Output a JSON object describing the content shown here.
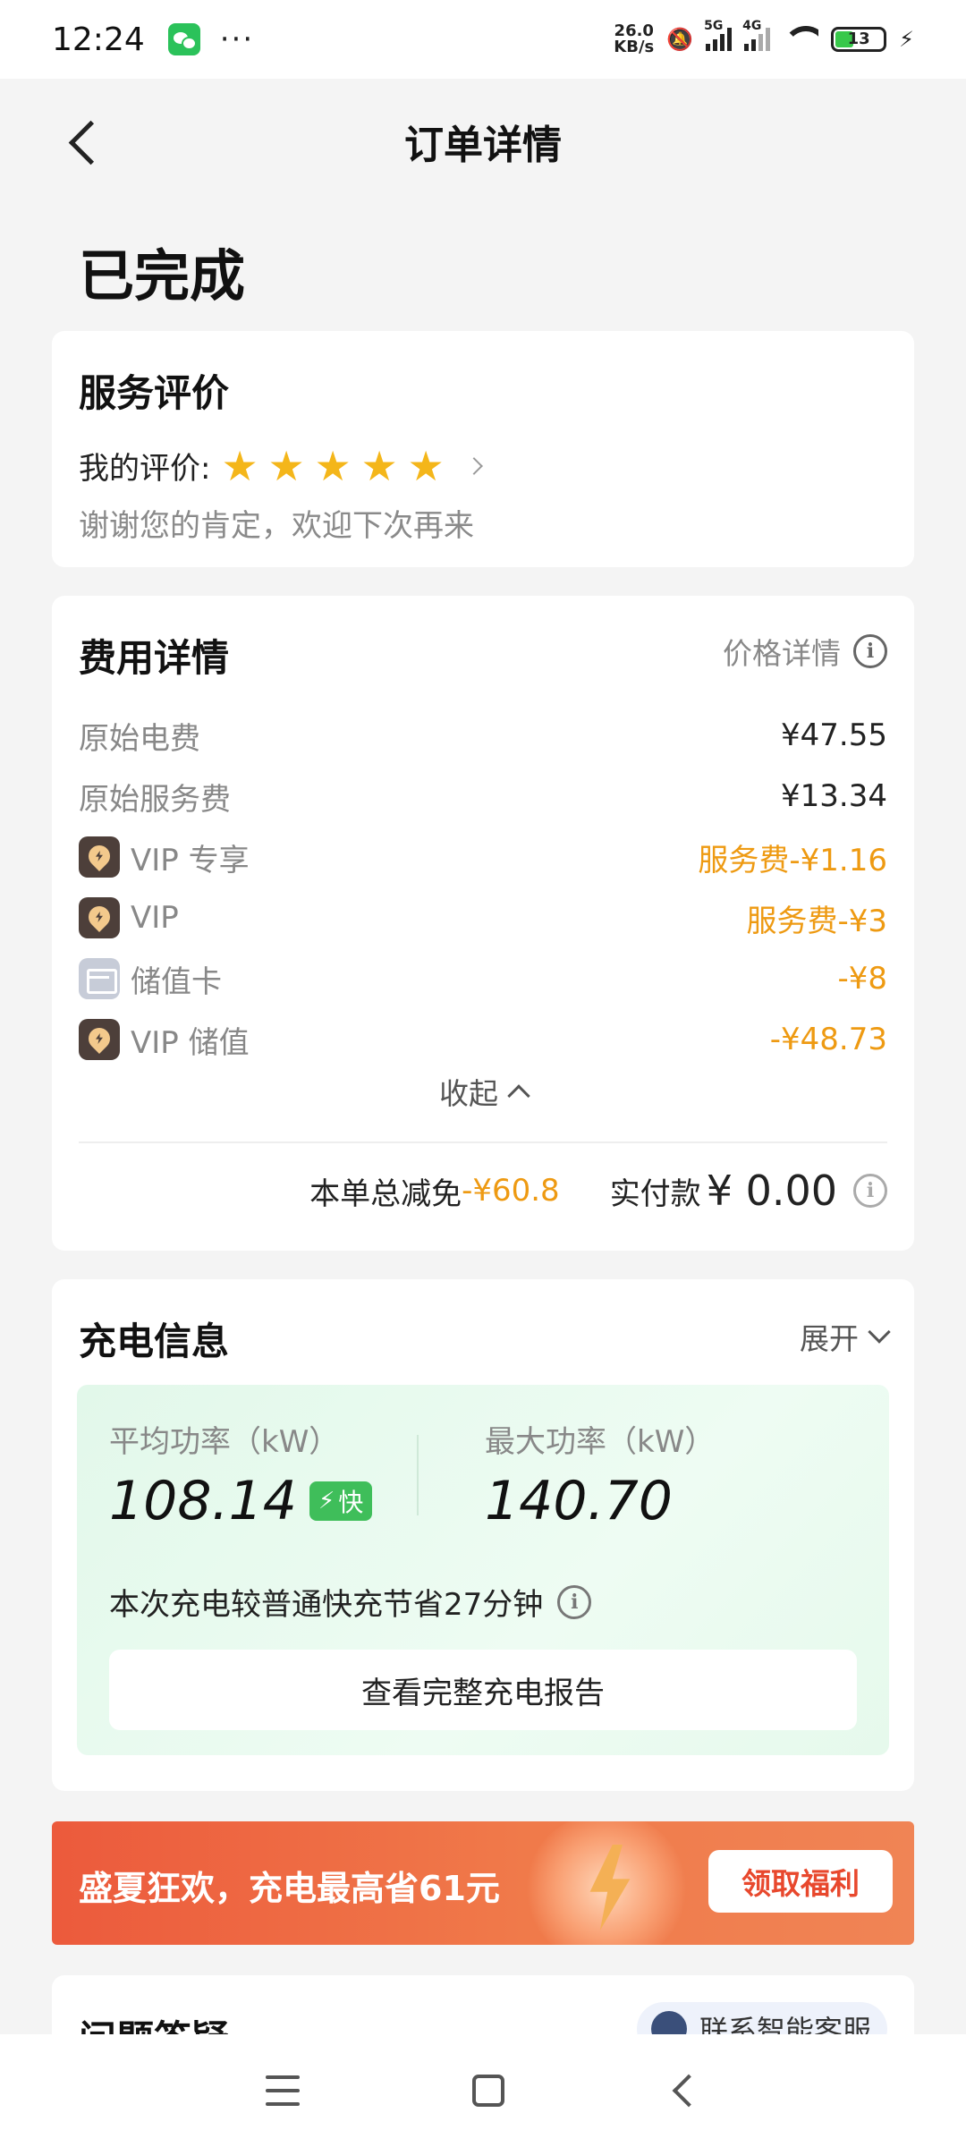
{
  "status_bar": {
    "time": "12:24",
    "net_speed_value": "26.0",
    "net_speed_unit": "KB/s",
    "signal_1_tag": "5G",
    "signal_2_tag": "4G",
    "battery_level": "13"
  },
  "header": {
    "title": "订单详情"
  },
  "order_status": "已完成",
  "rating": {
    "title": "服务评价",
    "label": "我的评价:",
    "stars": 5,
    "message": "谢谢您的肯定，欢迎下次再来"
  },
  "fees": {
    "title": "费用详情",
    "price_detail_label": "价格详情",
    "rows": [
      {
        "label": "原始电费",
        "value": "¥47.55"
      },
      {
        "label": "原始服务费",
        "value": "¥13.34"
      },
      {
        "label": "VIP 专享",
        "value": "服务费-¥1.16"
      },
      {
        "label": "VIP",
        "value": "服务费-¥3"
      },
      {
        "label": "储值卡",
        "value": "-¥8"
      },
      {
        "label": "VIP 储值",
        "value": "-¥48.73"
      }
    ],
    "collapse_label": "收起",
    "total_discount_label": "本单总减免",
    "total_discount_value": "-¥60.8",
    "paid_label": "实付款",
    "paid_value": "¥ 0.00"
  },
  "charging": {
    "title": "充电信息",
    "expand_label": "展开",
    "avg_power_label": "平均功率（kW）",
    "avg_power_value": "108.14",
    "fast_tag": "快",
    "max_power_label": "最大功率（kW）",
    "max_power_value": "140.70",
    "saving_text": "本次充电较普通快充节省27分钟",
    "report_button": "查看完整充电报告"
  },
  "promo": {
    "text": "盛夏狂欢，充电最高省61元",
    "button": "领取福利"
  },
  "faq": {
    "title": "问题答疑",
    "support_label": "联系智能客服"
  },
  "colors": {
    "accent_orange": "#ee9a12",
    "brand_green": "#3fbe5a",
    "promo_red": "#ec5a3c",
    "star_yellow": "#f4b61a"
  }
}
